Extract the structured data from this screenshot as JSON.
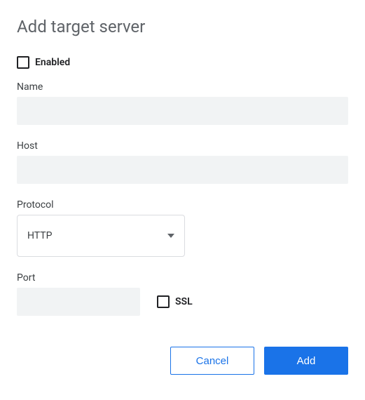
{
  "dialog": {
    "title": "Add target server",
    "enabled": {
      "label": "Enabled",
      "checked": false
    },
    "name": {
      "label": "Name",
      "value": ""
    },
    "host": {
      "label": "Host",
      "value": ""
    },
    "protocol": {
      "label": "Protocol",
      "value": "HTTP"
    },
    "port": {
      "label": "Port",
      "value": ""
    },
    "ssl": {
      "label": "SSL",
      "checked": false
    },
    "buttons": {
      "cancel": "Cancel",
      "add": "Add"
    }
  }
}
